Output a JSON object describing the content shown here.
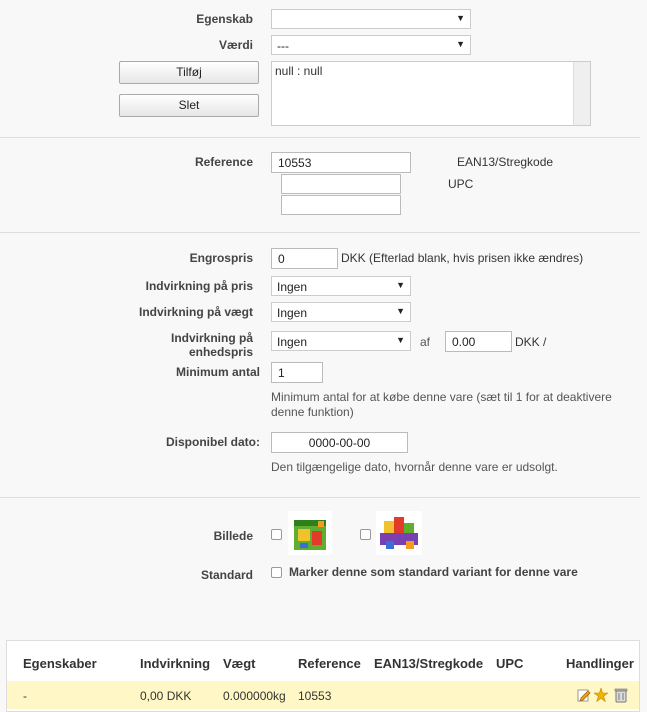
{
  "attr": {
    "egenskab_label": "Egenskab",
    "egenskab_value": "",
    "vaerdi_label": "Værdi",
    "vaerdi_value": "---",
    "add_button": "Tilføj",
    "delete_button": "Slet",
    "list_text": "null : null"
  },
  "refs": {
    "reference_label": "Reference",
    "reference_value": "10553",
    "ean_label": "EAN13/Stregkode",
    "ean_value": "",
    "upc_label": "UPC",
    "upc_value": ""
  },
  "pricing": {
    "engros_label": "Engrospris",
    "engros_value": "0",
    "engros_note": "DKK (Efterlad blank, hvis prisen ikke ændres)",
    "impact_price_label": "Indvirkning på pris",
    "impact_price_value": "Ingen",
    "impact_weight_label": "Indvirkning på vægt",
    "impact_weight_value": "Ingen",
    "impact_unit_label_1": "Indvirkning på",
    "impact_unit_label_2": "enhedspris",
    "impact_unit_value": "Ingen",
    "af_label": "af",
    "unit_price_value": "0.00",
    "unit_suffix": "DKK /",
    "min_label": "Minimum antal",
    "min_value": "1",
    "min_hint_1": "Minimum antal for at købe denne vare (sæt til 1 for at deaktivere",
    "min_hint_2": "denne funktion)",
    "date_label": "Disponibel dato:",
    "date_value": "0000-00-00",
    "date_hint": "Den tilgængelige dato, hvornår denne vare er udsolgt."
  },
  "images": {
    "label": "Billede",
    "standard_label": "Standard",
    "standard_text": "Marker denne som standard variant for denne vare"
  },
  "table": {
    "headers": [
      "Egenskaber",
      "Indvirkning",
      "Vægt",
      "Reference",
      "EAN13/Stregkode",
      "UPC",
      "Handlinger"
    ],
    "row": {
      "egenskaber": "-",
      "indvirkning": "0,00 DKK",
      "vaegt": "0.000000kg",
      "reference": "10553"
    }
  },
  "colors": {
    "row_highlight": "#fff7c6",
    "edit_icon": "#e8a020",
    "default_icon": "#f0b400"
  }
}
